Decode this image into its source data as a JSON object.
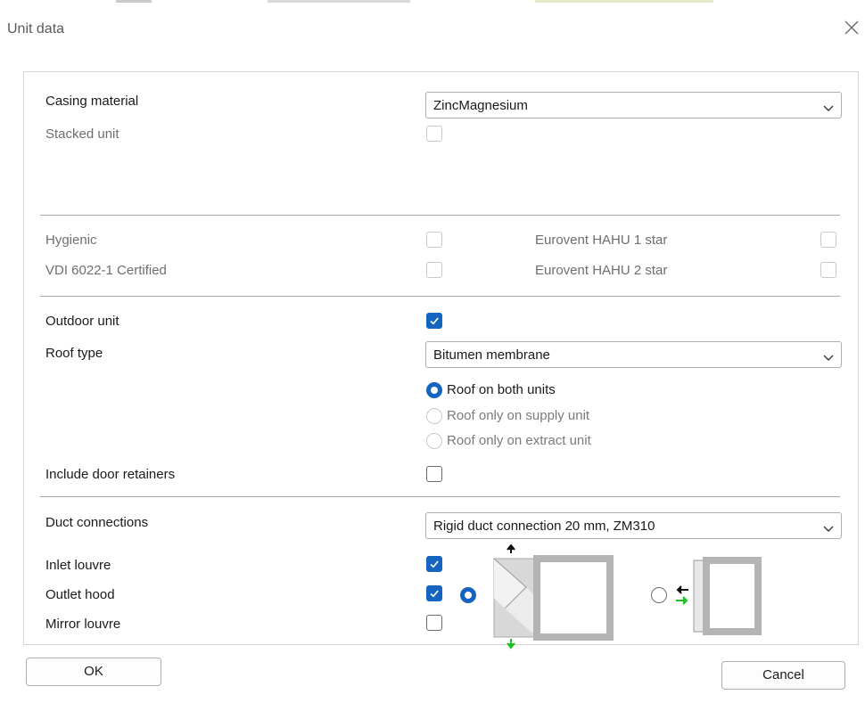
{
  "window": {
    "title": "Unit data"
  },
  "casing": {
    "label": "Casing material",
    "value": "ZincMagnesium",
    "stacked_label": "Stacked unit",
    "stacked_checked": false
  },
  "certs": {
    "hygienic_label": "Hygienic",
    "vdi_label": "VDI 6022-1 Certified",
    "eurovent1_label": "Eurovent HAHU 1 star",
    "eurovent2_label": "Eurovent HAHU 2 star"
  },
  "outdoor": {
    "label": "Outdoor unit",
    "checked": true,
    "roof_label": "Roof type",
    "roof_value": "Bitumen membrane",
    "roof_options": [
      "Roof on both units",
      "Roof only on supply unit",
      "Roof only on extract unit"
    ],
    "roof_selected": 0,
    "door_label": "Include door retainers",
    "door_checked": false
  },
  "ducts": {
    "label": "Duct connections",
    "value": "Rigid duct connection 20 mm, ZM310",
    "inlet_label": "Inlet louvre",
    "inlet_checked": true,
    "outlet_label": "Outlet hood",
    "outlet_checked": true,
    "mirror_label": "Mirror louvre",
    "mirror_checked": false
  },
  "buttons": {
    "ok": "OK",
    "cancel": "Cancel"
  },
  "colors": {
    "accent": "#1565c0",
    "arrow_green": "#22c022",
    "unit_gray": "#b4b4b4"
  }
}
